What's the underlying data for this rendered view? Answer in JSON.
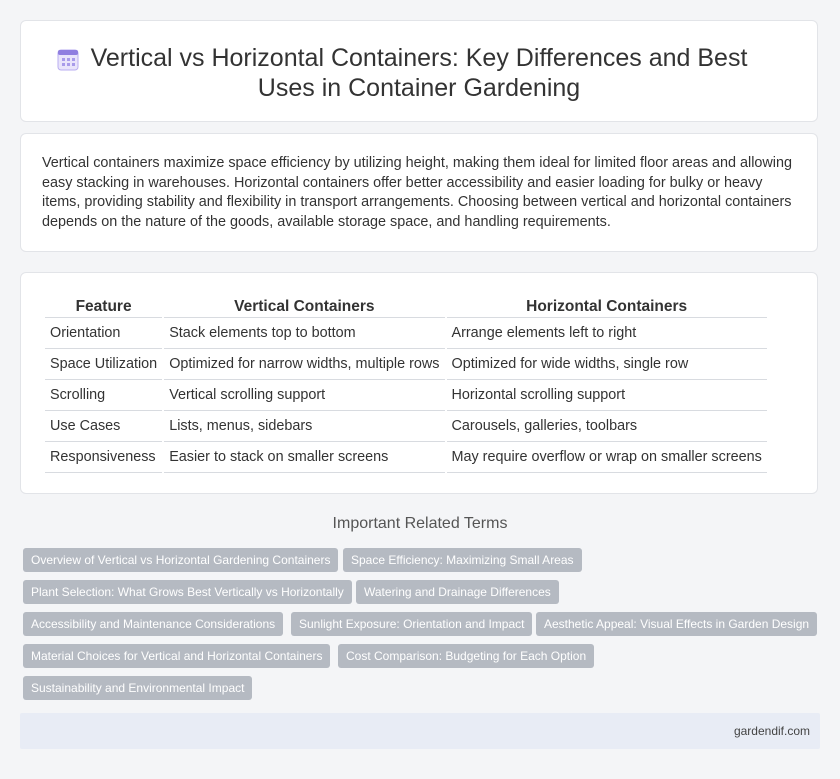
{
  "header": {
    "title": "Vertical vs Horizontal Containers: Key Differences and Best Uses in Container Gardening",
    "icon": "calendar-icon"
  },
  "intro": "Vertical containers maximize space efficiency by utilizing height, making them ideal for limited floor areas and allowing easy stacking in warehouses. Horizontal containers offer better accessibility and easier loading for bulky or heavy items, providing stability and flexibility in transport arrangements. Choosing between vertical and horizontal containers depends on the nature of the goods, available storage space, and handling requirements.",
  "table": {
    "headers": [
      "Feature",
      "Vertical Containers",
      "Horizontal Containers"
    ],
    "rows": [
      [
        "Orientation",
        "Stack elements top to bottom",
        "Arrange elements left to right"
      ],
      [
        "Space Utilization",
        "Optimized for narrow widths, multiple rows",
        "Optimized for wide widths, single row"
      ],
      [
        "Scrolling",
        "Vertical scrolling support",
        "Horizontal scrolling support"
      ],
      [
        "Use Cases",
        "Lists, menus, sidebars",
        "Carousels, galleries, toolbars"
      ],
      [
        "Responsiveness",
        "Easier to stack on smaller screens",
        "May require overflow or wrap on smaller screens"
      ]
    ]
  },
  "related": {
    "title": "Important Related Terms",
    "tags": [
      "Overview of Vertical vs Horizontal Gardening Containers",
      "Space Efficiency: Maximizing Small Areas",
      "Plant Selection: What Grows Best Vertically vs Horizontally",
      "Watering and Drainage Differences",
      "Accessibility and Maintenance Considerations",
      "Sunlight Exposure: Orientation and Impact",
      "Aesthetic Appeal: Visual Effects in Garden Design",
      "Material Choices for Vertical and Horizontal Containers",
      "Cost Comparison: Budgeting for Each Option",
      "Sustainability and Environmental Impact"
    ]
  },
  "footer": {
    "site": "gardendif.com"
  },
  "colors": {
    "tag_bg": "#b5bac2",
    "footer_bg": "#e8ecf5",
    "icon_accent": "#8f7ee0"
  }
}
